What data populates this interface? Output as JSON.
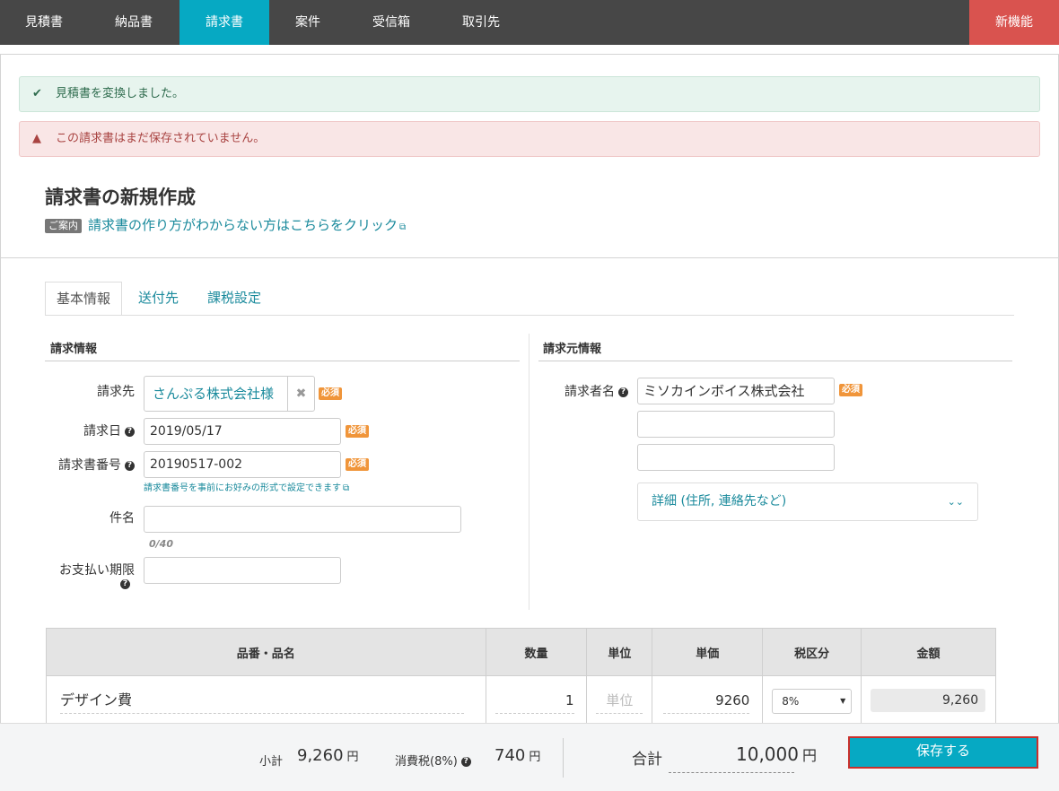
{
  "nav": {
    "items": [
      "見積書",
      "納品書",
      "請求書",
      "案件",
      "受信箱",
      "取引先"
    ],
    "new_features": "新機能"
  },
  "alerts": {
    "success": "見積書を変換しました。",
    "danger": "この請求書はまだ保存されていません。"
  },
  "header": {
    "title": "請求書の新規作成",
    "guide_badge": "ご案内",
    "guide_link": "請求書の作り方がわからない方はこちらをクリック"
  },
  "tabs": [
    "基本情報",
    "送付先",
    "課税設定"
  ],
  "invoice_info": {
    "heading": "請求情報",
    "client_label": "請求先",
    "client_value": "さんぷる株式会社様",
    "date_label": "請求日",
    "date_value": "2019/05/17",
    "number_label": "請求書番号",
    "number_value": "20190517-002",
    "number_hint": "請求書番号を事前にお好みの形式で設定できます",
    "subject_label": "件名",
    "subject_counter": "0/40",
    "due_label": "お支払い期限",
    "required": "必須"
  },
  "issuer_info": {
    "heading": "請求元情報",
    "name_label": "請求者名",
    "name_value": "ミソカインボイス株式会社",
    "detail_label": "詳細 (住所, 連絡先など)"
  },
  "table": {
    "headers": [
      "品番・品名",
      "数量",
      "単位",
      "単価",
      "税区分",
      "金額"
    ],
    "row": {
      "name": "デザイン費",
      "qty": "1",
      "unit_placeholder": "単位",
      "price": "9260",
      "tax": "8%",
      "amount": "9,260"
    }
  },
  "footer": {
    "subtotal_label": "小計",
    "subtotal_value": "9,260",
    "tax_label": "消費税(8%)",
    "tax_value": "740",
    "total_label": "合計",
    "total_value": "10,000",
    "yen": "円",
    "save": "保存する"
  },
  "colors": {
    "accent": "#06a9c3",
    "danger": "#d9534f",
    "required": "#f0953a"
  }
}
